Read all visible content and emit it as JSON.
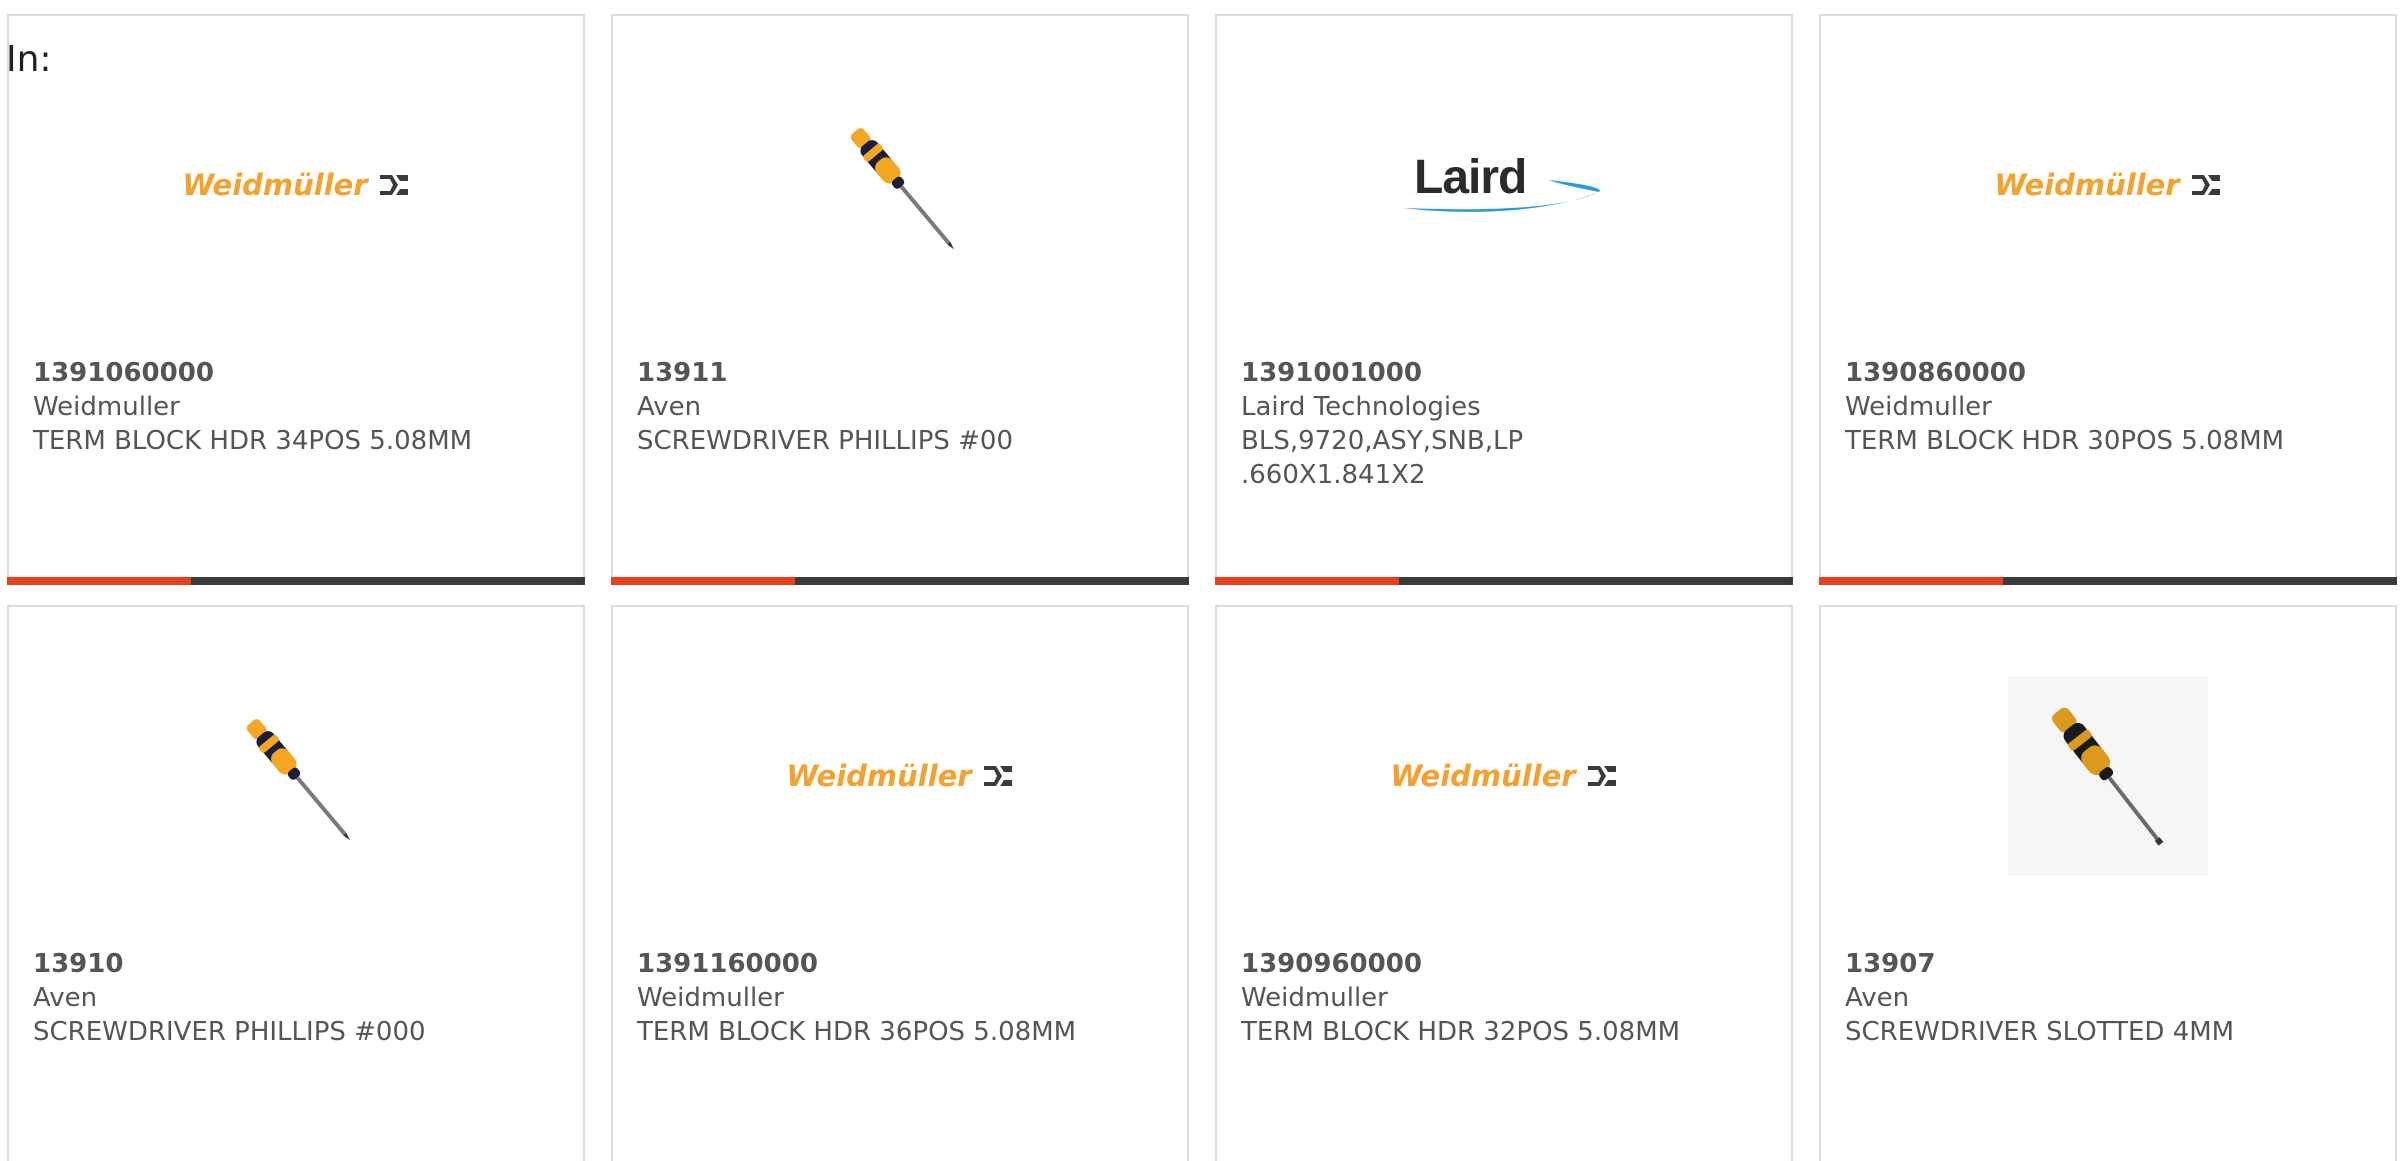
{
  "header": {
    "in_label": "In:"
  },
  "brand_colors": {
    "accent": "#e8401c",
    "bar": "#3a3a3a",
    "weidmuller": "#f3a12f",
    "laird_swoosh": "#2a9ad8"
  },
  "cards": [
    {
      "part": "1391060000",
      "manufacturer": "Weidmuller",
      "description": "TERM BLOCK HDR 34POS 5.08MM",
      "image": "weidmuller-logo",
      "logo_text": "Weidmüller"
    },
    {
      "part": "13911",
      "manufacturer": "Aven",
      "description": "SCREWDRIVER PHILLIPS #00",
      "image": "screwdriver-icon"
    },
    {
      "part": "1391001000",
      "manufacturer": "Laird Technologies",
      "description": "BLS,9720,ASY,SNB,LP .660X1.841X2",
      "image": "laird-logo",
      "logo_text": "Laird"
    },
    {
      "part": "1390860000",
      "manufacturer": "Weidmuller",
      "description": "TERM BLOCK HDR 30POS 5.08MM",
      "image": "weidmuller-logo",
      "logo_text": "Weidmüller"
    },
    {
      "part": "13910",
      "manufacturer": "Aven",
      "description": "SCREWDRIVER PHILLIPS #000",
      "image": "screwdriver-icon"
    },
    {
      "part": "1391160000",
      "manufacturer": "Weidmuller",
      "description": "TERM BLOCK HDR 36POS 5.08MM",
      "image": "weidmuller-logo",
      "logo_text": "Weidmüller"
    },
    {
      "part": "1390960000",
      "manufacturer": "Weidmuller",
      "description": "TERM BLOCK HDR 32POS 5.08MM",
      "image": "weidmuller-logo",
      "logo_text": "Weidmüller"
    },
    {
      "part": "13907",
      "manufacturer": "Aven",
      "description": "SCREWDRIVER SLOTTED 4MM",
      "image": "screwdriver-icon"
    }
  ]
}
